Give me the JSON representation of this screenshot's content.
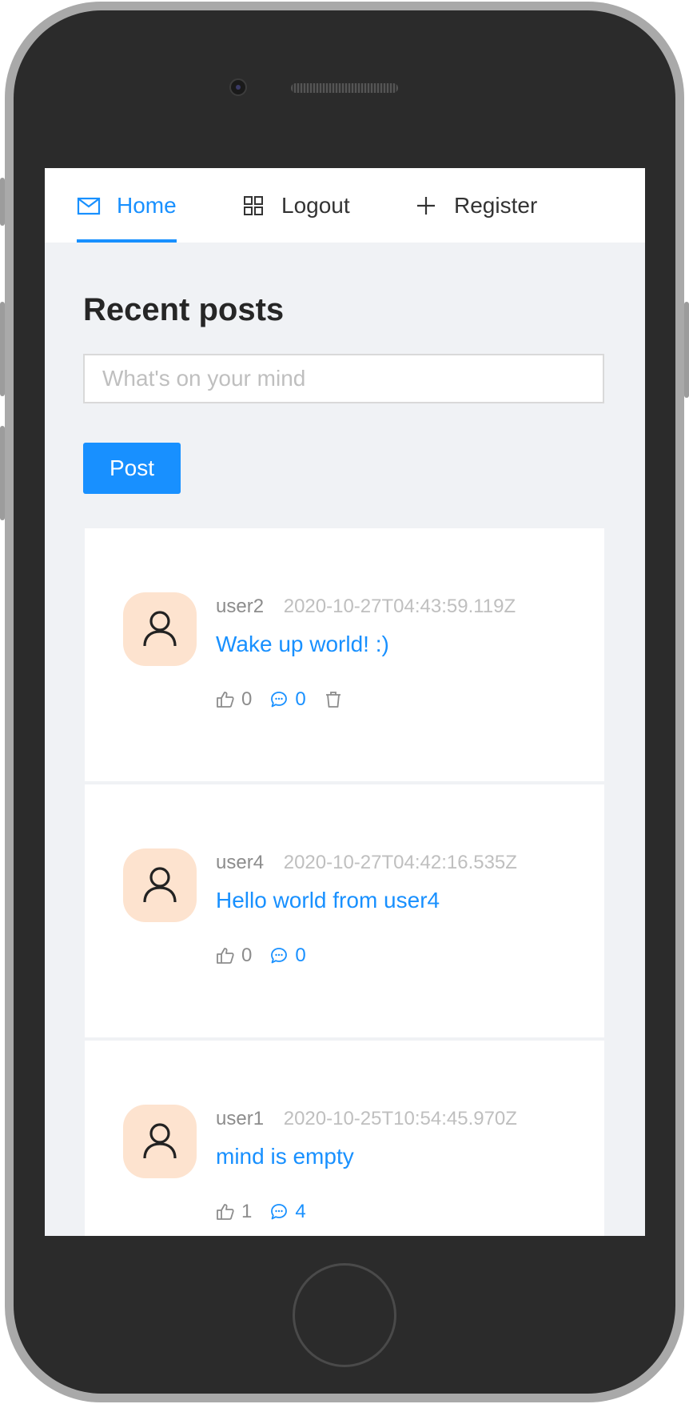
{
  "nav": {
    "items": [
      {
        "label": "Home",
        "icon": "mail-icon",
        "active": true
      },
      {
        "label": "Logout",
        "icon": "appstore-icon",
        "active": false
      },
      {
        "label": "Register",
        "icon": "plus-icon",
        "active": false
      }
    ]
  },
  "page": {
    "title": "Recent posts",
    "input_placeholder": "What's on your mind",
    "post_label": "Post"
  },
  "posts": [
    {
      "author": "user2",
      "time": "2020-10-27T04:43:59.119Z",
      "content": "Wake up world! :)",
      "likes": "0",
      "comments": "0",
      "deletable": true
    },
    {
      "author": "user4",
      "time": "2020-10-27T04:42:16.535Z",
      "content": "Hello world from user4",
      "likes": "0",
      "comments": "0",
      "deletable": false
    },
    {
      "author": "user1",
      "time": "2020-10-25T10:54:45.970Z",
      "content": "mind is empty",
      "likes": "1",
      "comments": "4",
      "deletable": false
    }
  ],
  "colors": {
    "accent": "#1890ff",
    "avatar_bg": "#fde3cf",
    "page_bg": "#f0f2f5"
  }
}
